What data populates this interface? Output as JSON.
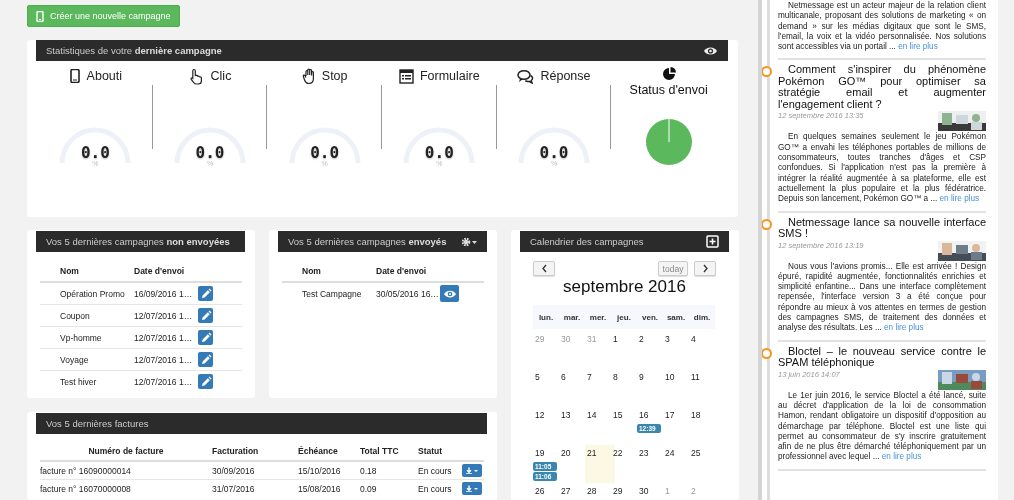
{
  "create_button": {
    "label": "Créer une nouvelle campagne"
  },
  "stats": {
    "title": "Statistiques de votre **dernière campagne**",
    "metrics": [
      {
        "kind": "phone",
        "label": "Abouti",
        "value": "0.0",
        "unit": "%"
      },
      {
        "kind": "click",
        "label": "Clic",
        "value": "0.0",
        "unit": "%"
      },
      {
        "kind": "stop",
        "label": "Stop",
        "value": "0.0",
        "unit": "%"
      },
      {
        "kind": "form",
        "label": "Formulaire",
        "value": "0.0",
        "unit": "%"
      },
      {
        "kind": "reply",
        "label": "Réponse",
        "value": "0.0",
        "unit": "%"
      }
    ],
    "status": {
      "label": "Status d'envoi"
    }
  },
  "unsent_campaigns": {
    "title": "Vos 5 dernières campagnes **non envoyées**",
    "columns": [
      "Nom",
      "Date d'envoi"
    ],
    "rows": [
      {
        "name": "Opération Promo",
        "date": "16/09/2016 1…",
        "kind": "edit"
      },
      {
        "name": "Coupon",
        "date": "12/07/2016 1…",
        "kind": "edit"
      },
      {
        "name": "Vp-homme",
        "date": "12/07/2016 1…",
        "kind": "edit"
      },
      {
        "name": "Voyage",
        "date": "12/07/2016 1…",
        "kind": "edit"
      },
      {
        "name": "Test hiver",
        "date": "12/07/2016 1…",
        "kind": "edit"
      }
    ]
  },
  "sent_campaigns": {
    "title": "Vos 5 dernières campagnes **envoyés**",
    "columns": [
      "Nom",
      "Date d'envoi"
    ],
    "rows": [
      {
        "name": "Test Campagne",
        "date": "30/05/2016 16…",
        "kind": "view"
      }
    ]
  },
  "invoices": {
    "title": "Vos 5 dernières factures",
    "columns": [
      "Numéro de facture",
      "Facturation",
      "Échéance",
      "Total TTC",
      "Statut"
    ],
    "rows": [
      {
        "number": "facture n° 16090000014",
        "billing": "30/09/2016",
        "due": "15/10/2016",
        "total": "0.18",
        "status": "En cours"
      },
      {
        "number": "facture n° 16070000008",
        "billing": "31/07/2016",
        "due": "15/08/2016",
        "total": "0.09",
        "status": "En cours"
      }
    ]
  },
  "calendar": {
    "title": "Calendrier des campagnes",
    "today_button": {
      "label": "today",
      "disabled": true
    },
    "month": "septembre 2016",
    "weekdays": [
      "lun.",
      "mar.",
      "mer.",
      "jeu.",
      "ven.",
      "sam.",
      "dim."
    ],
    "weeks": [
      [
        {
          "day": "29",
          "other_month": true,
          "today": false
        },
        {
          "day": "30",
          "other_month": true,
          "today": false
        },
        {
          "day": "31",
          "other_month": true,
          "today": false
        },
        {
          "day": "1",
          "other_month": false,
          "today": false
        },
        {
          "day": "2",
          "other_month": false,
          "today": false
        },
        {
          "day": "3",
          "other_month": false,
          "today": false
        },
        {
          "day": "4",
          "other_month": false,
          "today": false
        }
      ],
      [
        {
          "day": "5",
          "other_month": false,
          "today": false
        },
        {
          "day": "6",
          "other_month": false,
          "today": false
        },
        {
          "day": "7",
          "other_month": false,
          "today": false
        },
        {
          "day": "8",
          "other_month": false,
          "today": false
        },
        {
          "day": "9",
          "other_month": false,
          "today": false
        },
        {
          "day": "10",
          "other_month": false,
          "today": false
        },
        {
          "day": "11",
          "other_month": false,
          "today": false
        }
      ],
      [
        {
          "day": "12",
          "other_month": false,
          "today": false
        },
        {
          "day": "13",
          "other_month": false,
          "today": false
        },
        {
          "day": "14",
          "other_month": false,
          "today": false
        },
        {
          "day": "15",
          "other_month": false,
          "today": false
        },
        {
          "day": "16",
          "other_month": false,
          "today": false,
          "events": [
            "12:39"
          ]
        },
        {
          "day": "17",
          "other_month": false,
          "today": false
        },
        {
          "day": "18",
          "other_month": false,
          "today": false
        }
      ],
      [
        {
          "day": "19",
          "other_month": false,
          "today": false,
          "events": [
            "11:05",
            "11:06"
          ]
        },
        {
          "day": "20",
          "other_month": false,
          "today": false
        },
        {
          "day": "21",
          "other_month": false,
          "today": true
        },
        {
          "day": "22",
          "other_month": false,
          "today": false
        },
        {
          "day": "23",
          "other_month": false,
          "today": false
        },
        {
          "day": "24",
          "other_month": false,
          "today": false
        },
        {
          "day": "25",
          "other_month": false,
          "today": false
        }
      ],
      [
        {
          "day": "26",
          "other_month": false,
          "today": false
        },
        {
          "day": "27",
          "other_month": false,
          "today": false
        },
        {
          "day": "28",
          "other_month": false,
          "today": false
        },
        {
          "day": "29",
          "other_month": false,
          "today": false
        },
        {
          "day": "30",
          "other_month": false,
          "today": false
        },
        {
          "day": "1",
          "other_month": true,
          "today": false
        },
        {
          "day": "2",
          "other_month": true,
          "today": false
        }
      ]
    ]
  },
  "news": {
    "items": [
      {
        "body": "Netmessage est un acteur majeur de la relation client multicanale, proposant des solutions de marketing « on demand » sur les médias digitaux que sont le SMS, l'email, la voix et la vidéo personnalisée. Nos solutions sont accessibles via un portail ...",
        "link": "en lire plus"
      },
      {
        "title": "Comment s'inspirer du phénomène Pokémon GO™ pour optimiser sa stratégie email et augmenter l'engagement client ?",
        "date": "12 septembre 2016 13:35",
        "body": "En quelques semaines seulement le jeu Pokémon GO™ a envahi les téléphones portables de millions de consommateurs, toutes tranches d'âges et CSP confondues. Si l'application n'est pas la première à intégrer la réalité augmentée à sa plateforme, elle est actuellement la plus populaire et la plus fédératrice. Depuis son lancement, Pokémon GO™ a ...",
        "link": "en lire plus"
      },
      {
        "title": "Netmessage lance sa nouvelle interface SMS !",
        "date": "12 septembre 2016 13:19",
        "body": "Nous vous l'avions promis... Elle est arrivée ! Design épuré, rapidité augmentée, fonctionnalités enrichies et simplicité enfantine... Dans une interface complètement repensée, l'interface version 3 a été conçue pour répondre au mieux à vos attentes en termes de gestion des campagnes SMS, de traitement des données et analyse des résultats. Les ...",
        "link": "en lire plus"
      },
      {
        "title": "Bloctel – le nouveau service contre le SPAM téléphonique",
        "date": "13 juin 2016 14:07",
        "body": "Le 1er juin 2016, le service Bloctel a été lancé, suite au décret d'application de la loi de consommation Hamon, rendant obligatoire un dispositif d'opposition au démarchage par téléphone. Bloctel est une liste qui permet au consommateur de s'y inscrire gratuitement afin de ne plus être démarché téléphoniquement par un professionnel avec lequel ...",
        "link": "en lire plus"
      }
    ]
  }
}
